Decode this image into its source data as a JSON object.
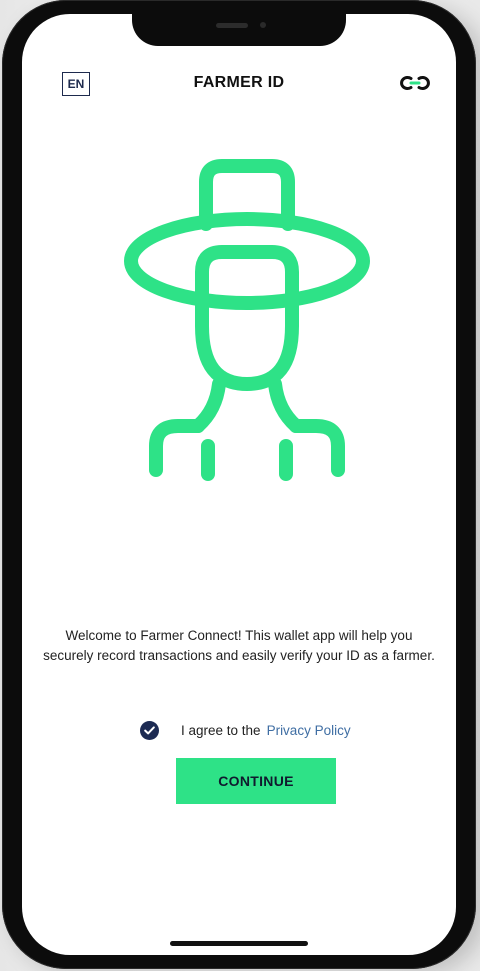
{
  "header": {
    "language": "EN",
    "title": "FARMER ID",
    "link_icon": "chain-link-icon"
  },
  "hero": {
    "icon": "farmer-avatar-icon",
    "color": "#2EE287"
  },
  "welcome": {
    "message": "Welcome to Farmer Connect! This wallet app will help you securely record transactions and easily verify your ID as a farmer."
  },
  "consent": {
    "checked": true,
    "prefix": "I agree to the",
    "link_label": "Privacy Policy",
    "checkbox_color": "#1C2A52",
    "link_color": "#3F6EA3"
  },
  "actions": {
    "continue_label": "CONTINUE",
    "button_color": "#2EE287"
  }
}
